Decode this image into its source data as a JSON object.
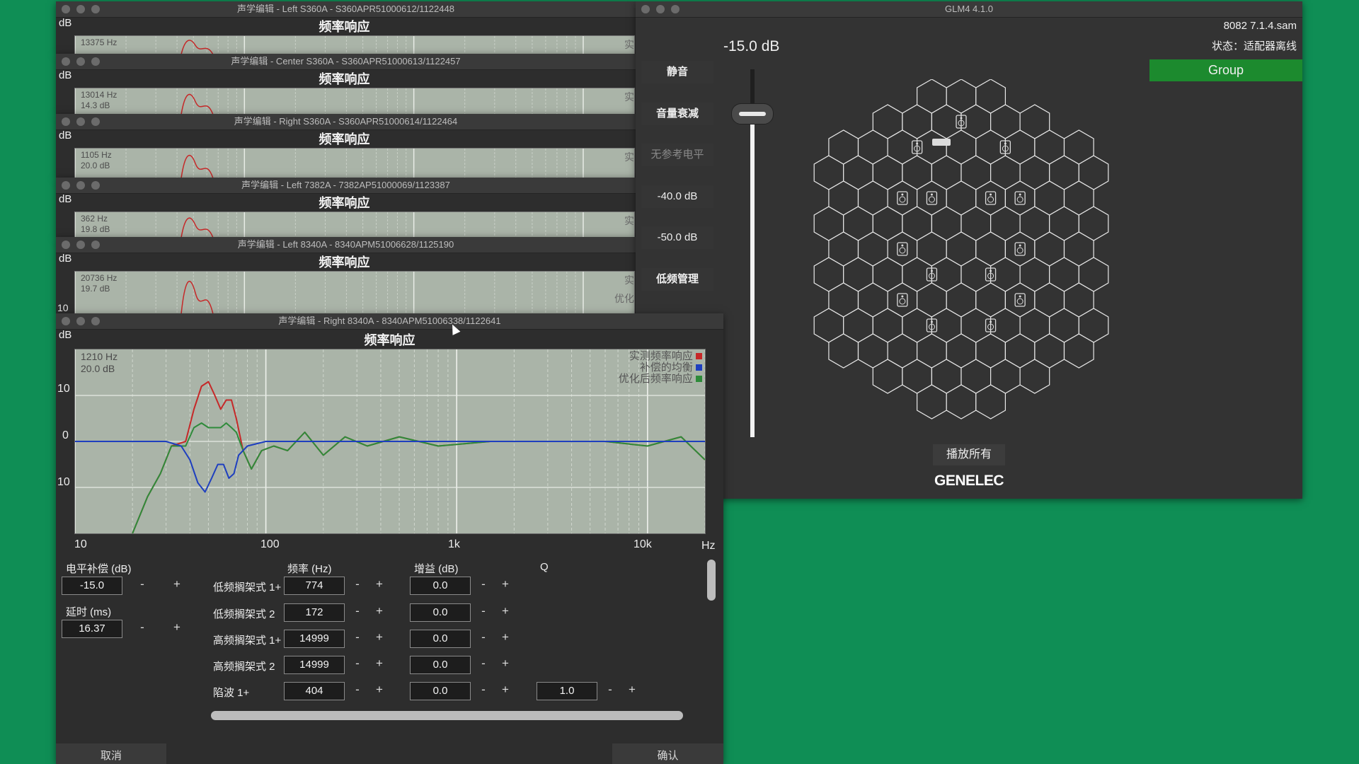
{
  "stacked_windows": [
    {
      "title": "声学编辑 - Left S360A - S360APR51000612/1122448",
      "subtitle": "频率响应",
      "db": "dB",
      "readout": [
        "13375 Hz",
        ""
      ],
      "side": "实"
    },
    {
      "title": "声学编辑 - Center S360A - S360APR51000613/1122457",
      "subtitle": "频率响应",
      "db": "dB",
      "readout": [
        "13014 Hz",
        "14.3 dB"
      ],
      "side": "实"
    },
    {
      "title": "声学编辑 - Right S360A - S360APR51000614/1122464",
      "subtitle": "频率响应",
      "db": "dB",
      "readout": [
        "1105 Hz",
        "20.0 dB"
      ],
      "side": "实"
    },
    {
      "title": "声学编辑 - Left 7382A - 7382AP51000069/1123387",
      "subtitle": "频率响应",
      "db": "dB",
      "readout": [
        "362 Hz",
        "19.8 dB"
      ],
      "side": "实"
    },
    {
      "title": "声学编辑 - Left 8340A - 8340APM51006628/1125190",
      "subtitle": "频率响应",
      "db": "dB",
      "readout": [
        "20736 Hz",
        "19.7 dB"
      ],
      "side": "实",
      "side2": "优化",
      "ytick": "10"
    }
  ],
  "main": {
    "title": "声学编辑 - Right 8340A - 8340APM51006338/1122641",
    "subtitle": "频率响应",
    "db": "dB",
    "readout": [
      "1210 Hz",
      "20.0 dB"
    ],
    "legend": [
      {
        "label": "实测频率响应",
        "color": "#c62828"
      },
      {
        "label": "补偿的均衡",
        "color": "#1e3fbf"
      },
      {
        "label": "优化后频率响应",
        "color": "#2e8b3a"
      }
    ],
    "y_ticks": [
      "10",
      "0",
      "10"
    ],
    "x_ticks": [
      "10",
      "100",
      "1k",
      "10k"
    ],
    "x_unit": "Hz",
    "level_comp": {
      "label": "电平补偿 (dB)",
      "value": "-15.0"
    },
    "delay": {
      "label": "延时 (ms)",
      "value": "16.37"
    },
    "headers": {
      "freq": "频率 (Hz)",
      "gain": "增益 (dB)",
      "q": "Q"
    },
    "filters": [
      {
        "name": "低频搁架式 1+",
        "freq": "774",
        "gain": "0.0",
        "q": ""
      },
      {
        "name": "低频搁架式 2",
        "freq": "172",
        "gain": "0.0",
        "q": ""
      },
      {
        "name": "高频搁架式 1+",
        "freq": "14999",
        "gain": "0.0",
        "q": ""
      },
      {
        "name": "高频搁架式 2",
        "freq": "14999",
        "gain": "0.0",
        "q": ""
      },
      {
        "name": "陷波 1+",
        "freq": "404",
        "gain": "0.0",
        "q": "1.0"
      }
    ],
    "minus": "-",
    "plus": "+",
    "cancel": "取消",
    "confirm": "确认"
  },
  "chart_data": {
    "type": "line",
    "title": "频率响应",
    "xlabel": "Hz",
    "ylabel": "dB",
    "x_scale": "log",
    "xlim": [
      10,
      20000
    ],
    "ylim": [
      -20,
      20
    ],
    "grid": true,
    "legend_position": "top-right",
    "series": [
      {
        "name": "实测频率响应",
        "color": "#c62828",
        "points": [
          [
            20,
            -20
          ],
          [
            24,
            -12
          ],
          [
            28,
            -7
          ],
          [
            32,
            -1
          ],
          [
            38,
            0
          ],
          [
            42,
            7
          ],
          [
            46,
            12
          ],
          [
            50,
            13
          ],
          [
            54,
            10
          ],
          [
            58,
            7
          ],
          [
            62,
            9
          ],
          [
            66,
            9
          ],
          [
            70,
            5
          ],
          [
            76,
            -2
          ],
          [
            84,
            -6
          ],
          [
            95,
            -2
          ],
          [
            110,
            -1
          ],
          [
            130,
            -2
          ],
          [
            160,
            2
          ],
          [
            200,
            -3
          ],
          [
            260,
            1
          ],
          [
            340,
            -1
          ],
          [
            500,
            1
          ],
          [
            800,
            -1
          ],
          [
            1500,
            0
          ],
          [
            3000,
            0
          ],
          [
            6000,
            0
          ],
          [
            10000,
            -1
          ],
          [
            15000,
            1
          ],
          [
            20000,
            -4
          ]
        ]
      },
      {
        "name": "补偿的均衡",
        "color": "#1e3fbf",
        "points": [
          [
            10,
            0
          ],
          [
            30,
            0
          ],
          [
            36,
            -1
          ],
          [
            40,
            -4
          ],
          [
            44,
            -9
          ],
          [
            48,
            -11
          ],
          [
            52,
            -8
          ],
          [
            56,
            -5
          ],
          [
            60,
            -5
          ],
          [
            64,
            -8
          ],
          [
            68,
            -7
          ],
          [
            72,
            -3
          ],
          [
            80,
            -1
          ],
          [
            100,
            0
          ],
          [
            1000,
            0
          ],
          [
            20000,
            0
          ]
        ]
      },
      {
        "name": "优化后频率响应",
        "color": "#2e8b3a",
        "points": [
          [
            20,
            -20
          ],
          [
            24,
            -12
          ],
          [
            28,
            -7
          ],
          [
            32,
            -1
          ],
          [
            38,
            -1
          ],
          [
            42,
            3
          ],
          [
            46,
            4
          ],
          [
            50,
            3
          ],
          [
            54,
            3
          ],
          [
            58,
            3
          ],
          [
            62,
            4
          ],
          [
            66,
            3
          ],
          [
            70,
            2
          ],
          [
            76,
            -2
          ],
          [
            84,
            -6
          ],
          [
            95,
            -2
          ],
          [
            110,
            -1
          ],
          [
            130,
            -2
          ],
          [
            160,
            2
          ],
          [
            200,
            -3
          ],
          [
            260,
            1
          ],
          [
            340,
            -1
          ],
          [
            500,
            1
          ],
          [
            800,
            -1
          ],
          [
            1500,
            0
          ],
          [
            3000,
            0
          ],
          [
            6000,
            0
          ],
          [
            10000,
            -1
          ],
          [
            15000,
            1
          ],
          [
            20000,
            -4
          ]
        ]
      }
    ]
  },
  "glm": {
    "title": "GLM4  4.1.0",
    "file": "8082 7.1.4.sam",
    "status": "状态：适配器离线",
    "volume": "-15.0 dB",
    "volume_level": 0.12,
    "buttons": [
      "静音",
      "音量衰减",
      "无参考电平",
      "-40.0 dB",
      "-50.0 dB",
      "低频管理"
    ],
    "group": "Group",
    "play_all": "播放所有",
    "brand": "GENELEC",
    "accent": "#1c8a2e"
  }
}
